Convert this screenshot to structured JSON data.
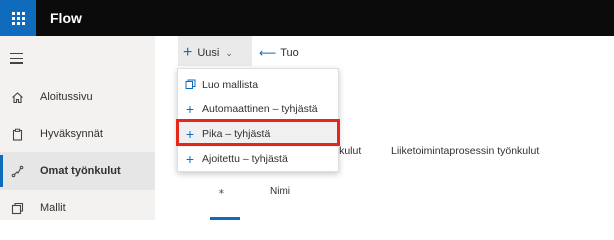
{
  "app": {
    "title": "Flow"
  },
  "sidebar": {
    "items": [
      {
        "label": "Aloitussivu",
        "icon": "home-icon"
      },
      {
        "label": "Hyväksynnät",
        "icon": "approvals-icon"
      },
      {
        "label": "Omat työnkulut",
        "icon": "flows-icon",
        "active": true
      },
      {
        "label": "Mallit",
        "icon": "templates-icon"
      }
    ]
  },
  "command_bar": {
    "new_label": "Uusi",
    "import_label": "Tuo"
  },
  "new_menu": {
    "items": [
      {
        "label": "Luo mallista",
        "icon": "template-icon"
      },
      {
        "label": "Automaattinen – tyhjästä",
        "icon": "plus-icon"
      },
      {
        "label": "Pika – tyhjästä",
        "icon": "plus-icon",
        "highlighted": true
      },
      {
        "label": "Ajoitettu – tyhjästä",
        "icon": "plus-icon"
      }
    ]
  },
  "main": {
    "tab_partial": "ynkulut",
    "tab_business": "Liiketoimintaprosessin työnkulut",
    "column_name": "Nimi"
  },
  "colors": {
    "accent": "#0f6cbd",
    "topbar": "#0b0b0b",
    "highlight": "#e5271b"
  }
}
